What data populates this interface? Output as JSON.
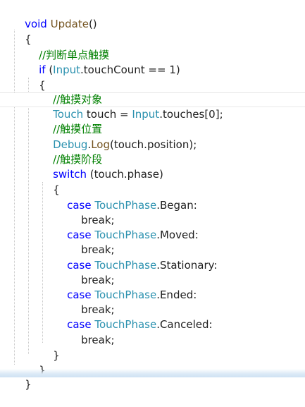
{
  "code": {
    "l1": {
      "kw": "void",
      "name": "Update",
      "rest": "()"
    },
    "l2": "{",
    "l3": "//判断单点触摸",
    "l4": {
      "kw": "if",
      "p1": "(",
      "cls": "Input",
      "rest": ".touchCount == 1)"
    },
    "l5": "{",
    "l6": "//触摸对象",
    "l7": {
      "type": "Touch",
      "var": " touch = ",
      "cls": "Input",
      "rest": ".touches[0];"
    },
    "l8": "//触摸位置",
    "l9": {
      "cls": "Debug",
      "dot": ".",
      "method": "Log",
      "rest": "(touch.position);"
    },
    "l10": "//触摸阶段",
    "l11": {
      "kw": "switch",
      "rest": " (touch.phase)"
    },
    "l12": "{",
    "cases": [
      {
        "kw": "case",
        "type": "TouchPhase",
        "member": ".Began:",
        "brk": "break;"
      },
      {
        "kw": "case",
        "type": "TouchPhase",
        "member": ".Moved:",
        "brk": "break;"
      },
      {
        "kw": "case",
        "type": "TouchPhase",
        "member": ".Stationary:",
        "brk": "break;"
      },
      {
        "kw": "case",
        "type": "TouchPhase",
        "member": ".Ended:",
        "brk": "break;"
      },
      {
        "kw": "case",
        "type": "TouchPhase",
        "member": ".Canceled:",
        "brk": "break;"
      }
    ],
    "close_switch": "}",
    "close_if": "}",
    "close_method": "}"
  }
}
